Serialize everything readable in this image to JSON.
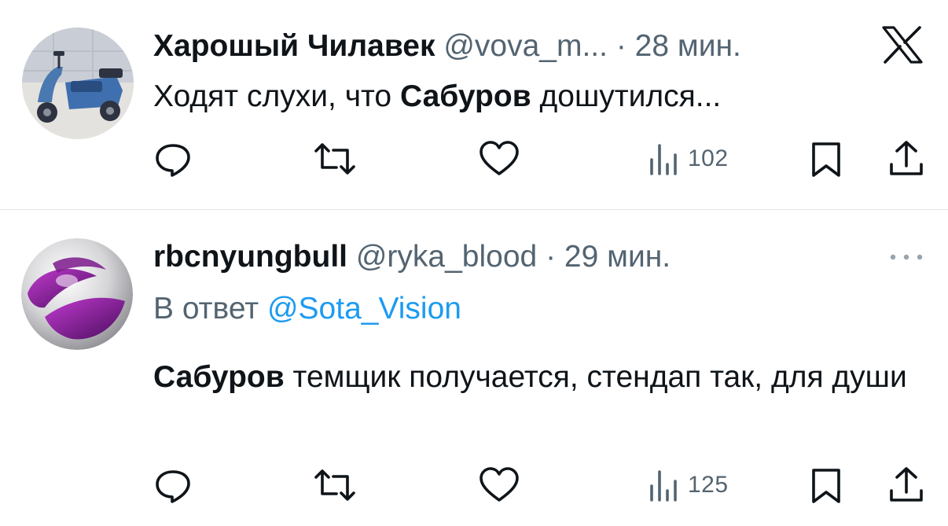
{
  "tweets": [
    {
      "display_name": "Харошый Чилавек",
      "handle": "@vova_m...",
      "separator": "·",
      "time": "28 мин.",
      "text_before": "Ходят слухи, что ",
      "text_bold": "Сабуров",
      "text_after": " дошутился...",
      "views": "102",
      "avatar_icon": "scooter-photo",
      "corner_icon": "x-logo-icon"
    },
    {
      "display_name": "rbcnyungbull",
      "handle": "@ryka_blood",
      "separator": "·",
      "time": "29 мин.",
      "reply_prefix": "В ответ",
      "reply_mention": "@Sota_Vision",
      "text_bold": "Сабуров",
      "text_after": " темщик получается, стендап так, для души",
      "views": "125",
      "avatar_icon": "sony-ericsson-logo",
      "corner_icon": "more-dots-icon"
    }
  ],
  "colors": {
    "text": "#0f1419",
    "secondary": "#536471",
    "link": "#1d9bf0",
    "divider": "#e6e6e6"
  }
}
